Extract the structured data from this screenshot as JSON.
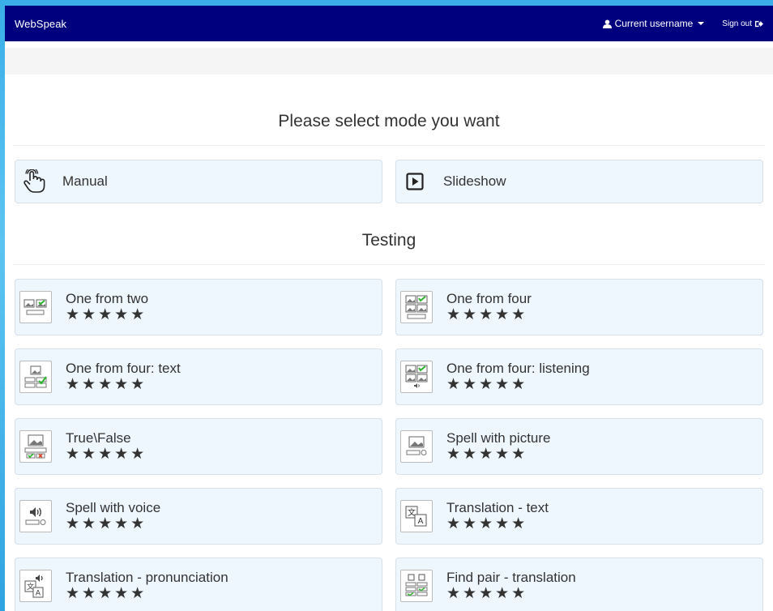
{
  "navbar": {
    "brand": "WebSpeak",
    "username": "Current username",
    "signout": "Sign out"
  },
  "heading": "Please select mode you want",
  "modes": [
    {
      "label": "Manual",
      "icon": "hand-pointer-icon"
    },
    {
      "label": "Slideshow",
      "icon": "play-square-icon"
    }
  ],
  "testing_heading": "Testing",
  "tests": [
    {
      "label": "One from two",
      "icon": "two-pictures-icon",
      "stars": "★★★★★"
    },
    {
      "label": "One from four",
      "icon": "four-pictures-icon",
      "stars": "★★★★★"
    },
    {
      "label": "One from four: text",
      "icon": "picture-text-choice-icon",
      "stars": "★★★★★"
    },
    {
      "label": "One from four: listening",
      "icon": "four-pictures-audio-icon",
      "stars": "★★★★★"
    },
    {
      "label": "True\\False",
      "icon": "true-false-icon",
      "stars": "★★★★★"
    },
    {
      "label": "Spell with picture",
      "icon": "picture-spell-icon",
      "stars": "★★★★★"
    },
    {
      "label": "Spell with voice",
      "icon": "speaker-spell-icon",
      "stars": "★★★★★"
    },
    {
      "label": "Translation - text",
      "icon": "translate-icon",
      "stars": "★★★★★"
    },
    {
      "label": "Translation - pronunciation",
      "icon": "translate-speaker-icon",
      "stars": "★★★★★"
    },
    {
      "label": "Find pair - translation",
      "icon": "find-pair-icon",
      "stars": "★★★★★"
    }
  ]
}
